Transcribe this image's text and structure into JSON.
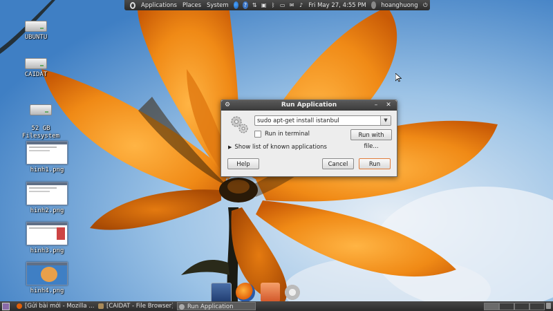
{
  "top_panel": {
    "menus": [
      "Applications",
      "Places",
      "System"
    ],
    "clock": "Fri May 27,  4:55 PM",
    "username": "hoanghuong",
    "icons": [
      "ubuntu-logo-icon",
      "firefox-icon",
      "help-icon",
      "network-icon",
      "camera-icon",
      "bluetooth-icon",
      "battery-icon",
      "mail-icon",
      "volume-icon",
      "user-icon",
      "power-icon"
    ]
  },
  "desktop_icons": [
    {
      "label": "UBUNTU",
      "type": "drive"
    },
    {
      "label": "CAIDAT",
      "type": "drive"
    },
    {
      "label": "52 GB\nFilesystem",
      "type": "drive"
    },
    {
      "label": "hinh1.png",
      "type": "image"
    },
    {
      "label": "hinh2.png",
      "type": "image"
    },
    {
      "label": "hinh3.png",
      "type": "image"
    },
    {
      "label": "hinh4.png",
      "type": "image"
    }
  ],
  "run_dialog": {
    "title": "Run Application",
    "command_value": "sudo apt-get install istanbul",
    "run_in_terminal_label": "Run in terminal",
    "run_in_terminal_checked": false,
    "run_with_file_label": "Run with file...",
    "show_list_label": "Show list of known applications",
    "help_label": "Help",
    "cancel_label": "Cancel",
    "run_label": "Run"
  },
  "bottom_panel": {
    "tasks": [
      {
        "label": "[Gửi bài mới - Mozilla ...",
        "active": false
      },
      {
        "label": "[CAIDAT - File Browser]",
        "active": false
      },
      {
        "label": "Run Application",
        "active": true
      }
    ]
  },
  "colors": {
    "panel": "#2c2c2c",
    "accent_run_button": "#e07b3a",
    "sky": "#7fb3de",
    "petal": "#f08a16"
  }
}
